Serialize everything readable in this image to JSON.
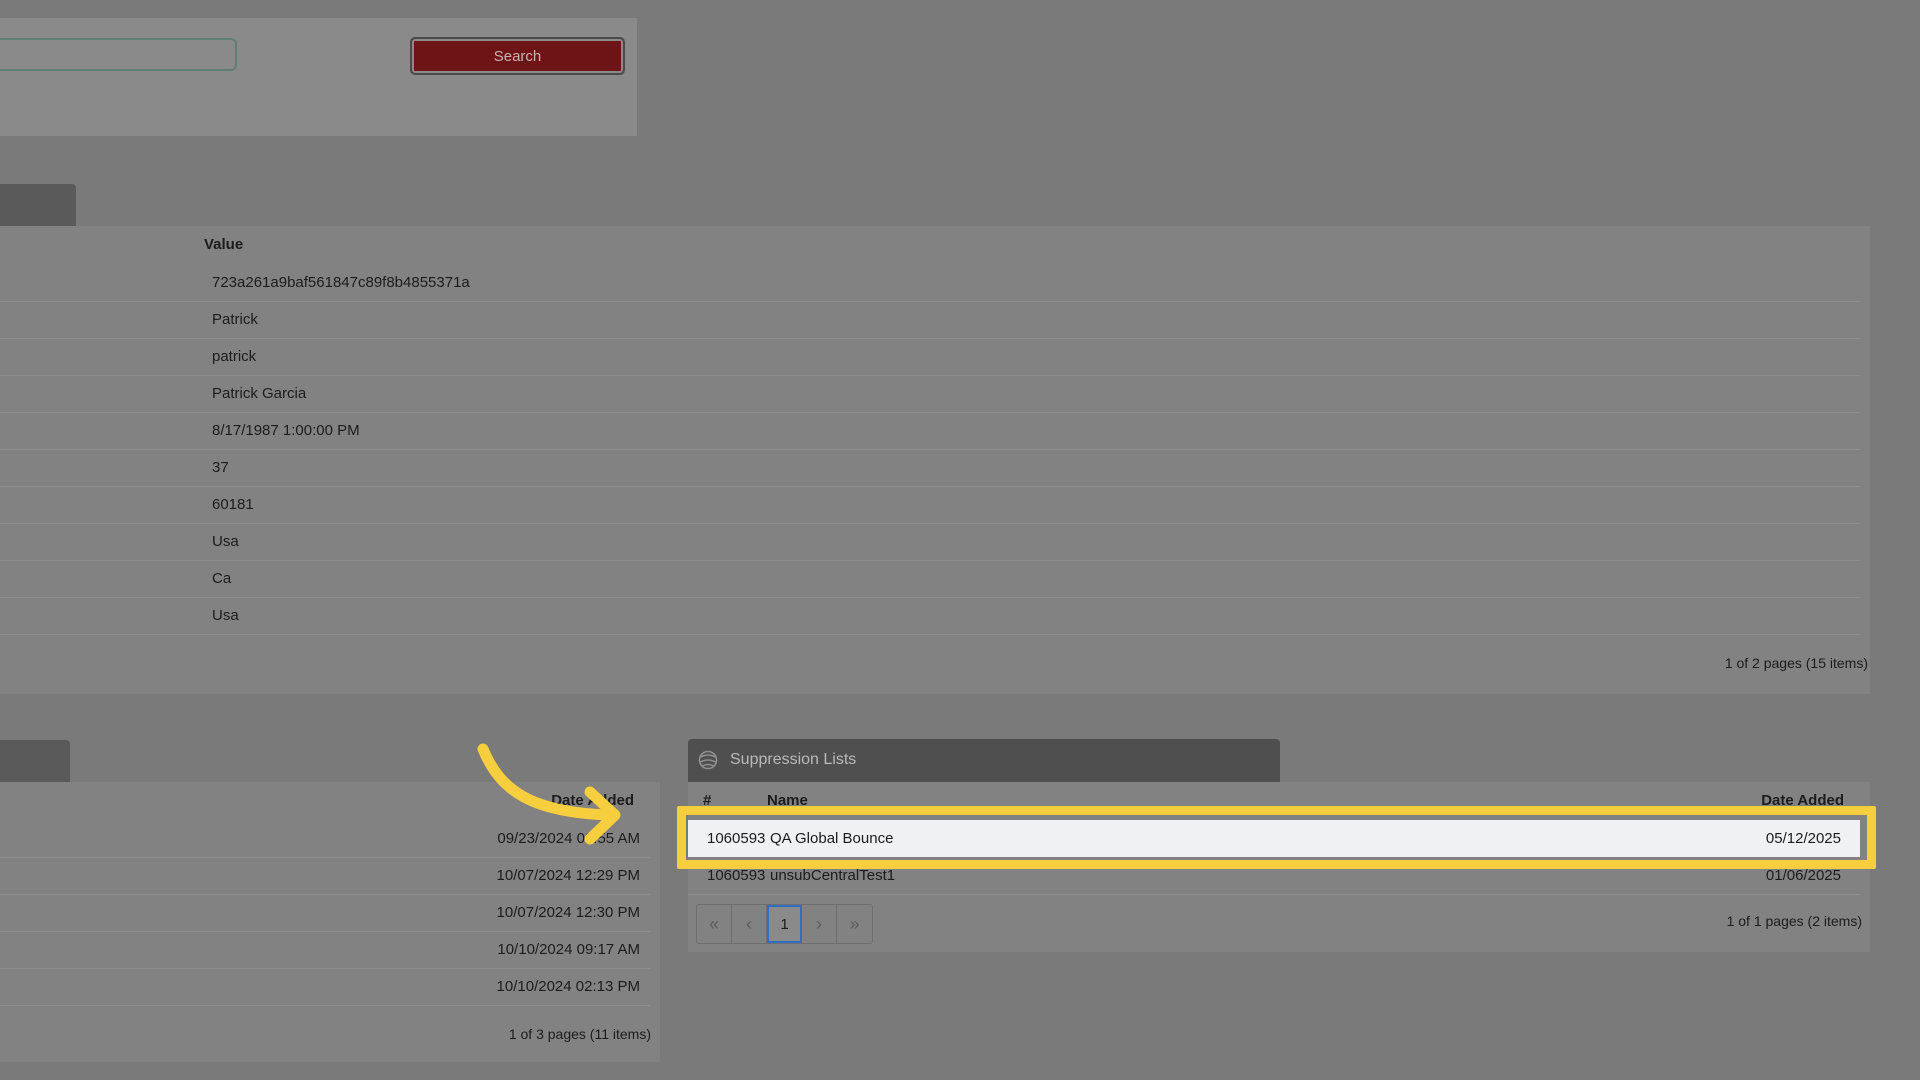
{
  "search": {
    "button_label": "Search",
    "value": ""
  },
  "attributes": {
    "column_value": "Value",
    "rows": [
      "723a261a9baf561847c89f8b4855371a",
      "Patrick",
      "patrick",
      "Patrick Garcia",
      "8/17/1987 1:00:00 PM",
      "37",
      "60181",
      "Usa",
      "Ca",
      "Usa"
    ],
    "footer": "1 of 2 pages (15 items)"
  },
  "history": {
    "column_date": "Date Added",
    "rows": [
      "09/23/2024 09:55 AM",
      "10/07/2024 12:29 PM",
      "10/07/2024 12:30 PM",
      "10/10/2024 09:17 AM",
      "10/10/2024 02:13 PM"
    ],
    "footer": "1 of 3 pages (11 items)"
  },
  "suppression": {
    "title": "Suppression Lists",
    "icon": "globe-icon",
    "columns": {
      "id": "#",
      "name": "Name",
      "date": "Date Added"
    },
    "rows": [
      {
        "id": "1060593",
        "name": "QA Global Bounce",
        "date": "05/12/2025"
      },
      {
        "id": "1060593",
        "name": "unsubCentralTest1",
        "date": "01/06/2025"
      }
    ],
    "pager": {
      "first": "«",
      "prev": "‹",
      "page": "1",
      "next": "›",
      "last": "»"
    },
    "footer": "1 of 1 pages (2 items)"
  },
  "colors": {
    "highlight": "#f7ce3d",
    "search_button": "#6e1316",
    "active_page": "#2f6fc3"
  }
}
